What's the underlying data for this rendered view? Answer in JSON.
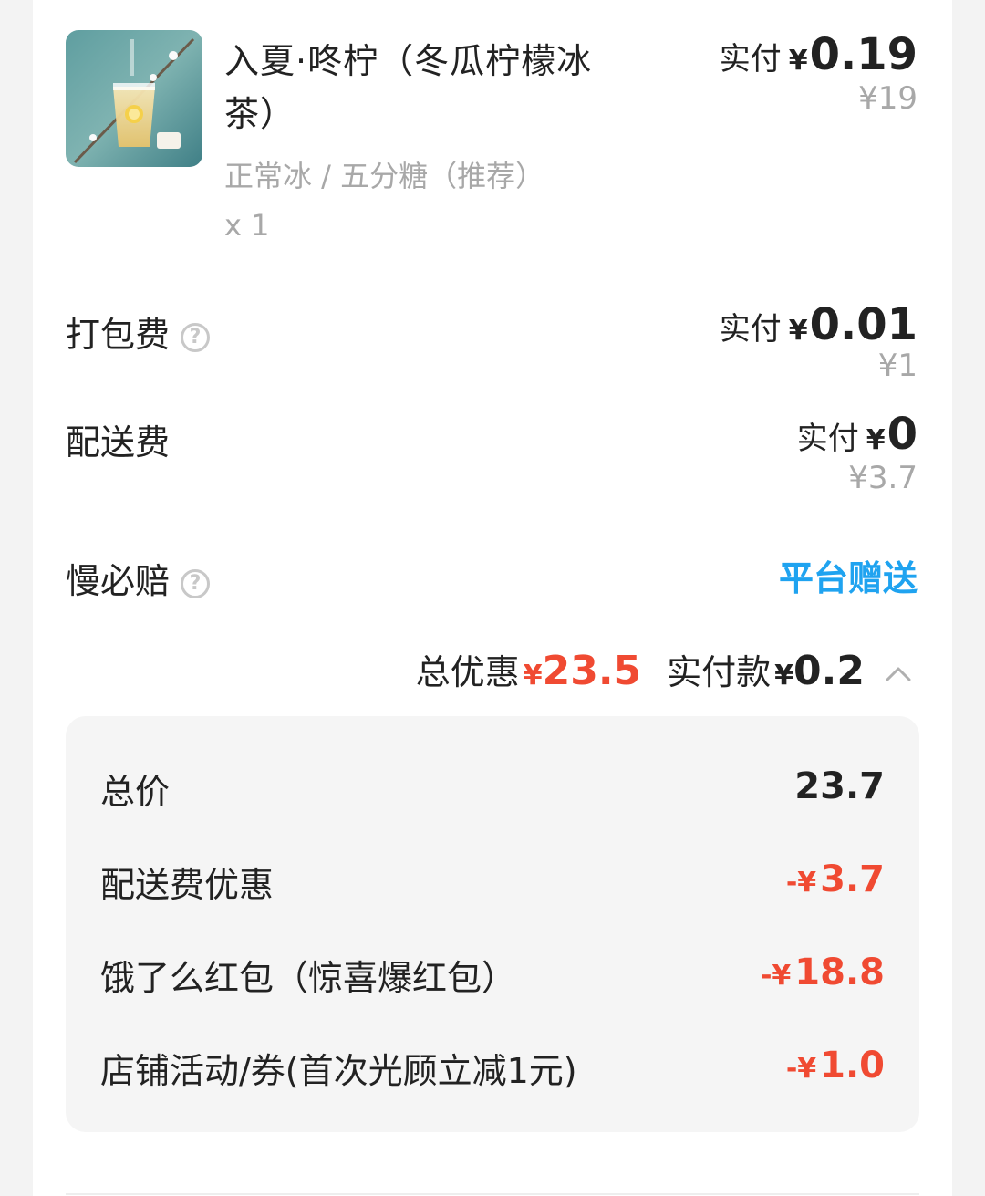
{
  "product": {
    "name": "入夏·咚柠（冬瓜柠檬冰茶）",
    "spec": "正常冰 / 五分糖（推荐）",
    "qty": "x 1",
    "paid_label": "实付",
    "currency": "¥",
    "paid": "0.19",
    "original": "¥19"
  },
  "packing": {
    "label": "打包费",
    "help_icon": "question-circle-icon",
    "paid_label": "实付",
    "currency": "¥",
    "paid": "0.01",
    "original": "¥1"
  },
  "delivery": {
    "label": "配送费",
    "paid_label": "实付",
    "currency": "¥",
    "paid": "0",
    "original": "¥3.7"
  },
  "late_comp": {
    "label": "慢必赔",
    "help_icon": "question-circle-icon",
    "value": "平台赠送"
  },
  "summary": {
    "discount_label": "总优惠",
    "discount_currency": "¥",
    "discount": "23.5",
    "paid_label": "实付款",
    "paid_currency": "¥",
    "paid": "0.2",
    "collapse_icon": "chevron-up-icon"
  },
  "breakdown": {
    "rows": [
      {
        "label": "总价",
        "prefix": "",
        "value": "23.7"
      },
      {
        "label": "配送费优惠",
        "prefix": "-¥",
        "value": "3.7"
      },
      {
        "label": "饿了么红包（惊喜爆红包）",
        "prefix": "-¥",
        "value": "18.8"
      },
      {
        "label": "店铺活动/券(首次光顾立减1元)",
        "prefix": "-¥",
        "value": "1.0"
      }
    ]
  },
  "colors": {
    "accent_red": "#f04a32",
    "accent_blue": "#1fa3f0",
    "muted": "#a8a8a8"
  }
}
